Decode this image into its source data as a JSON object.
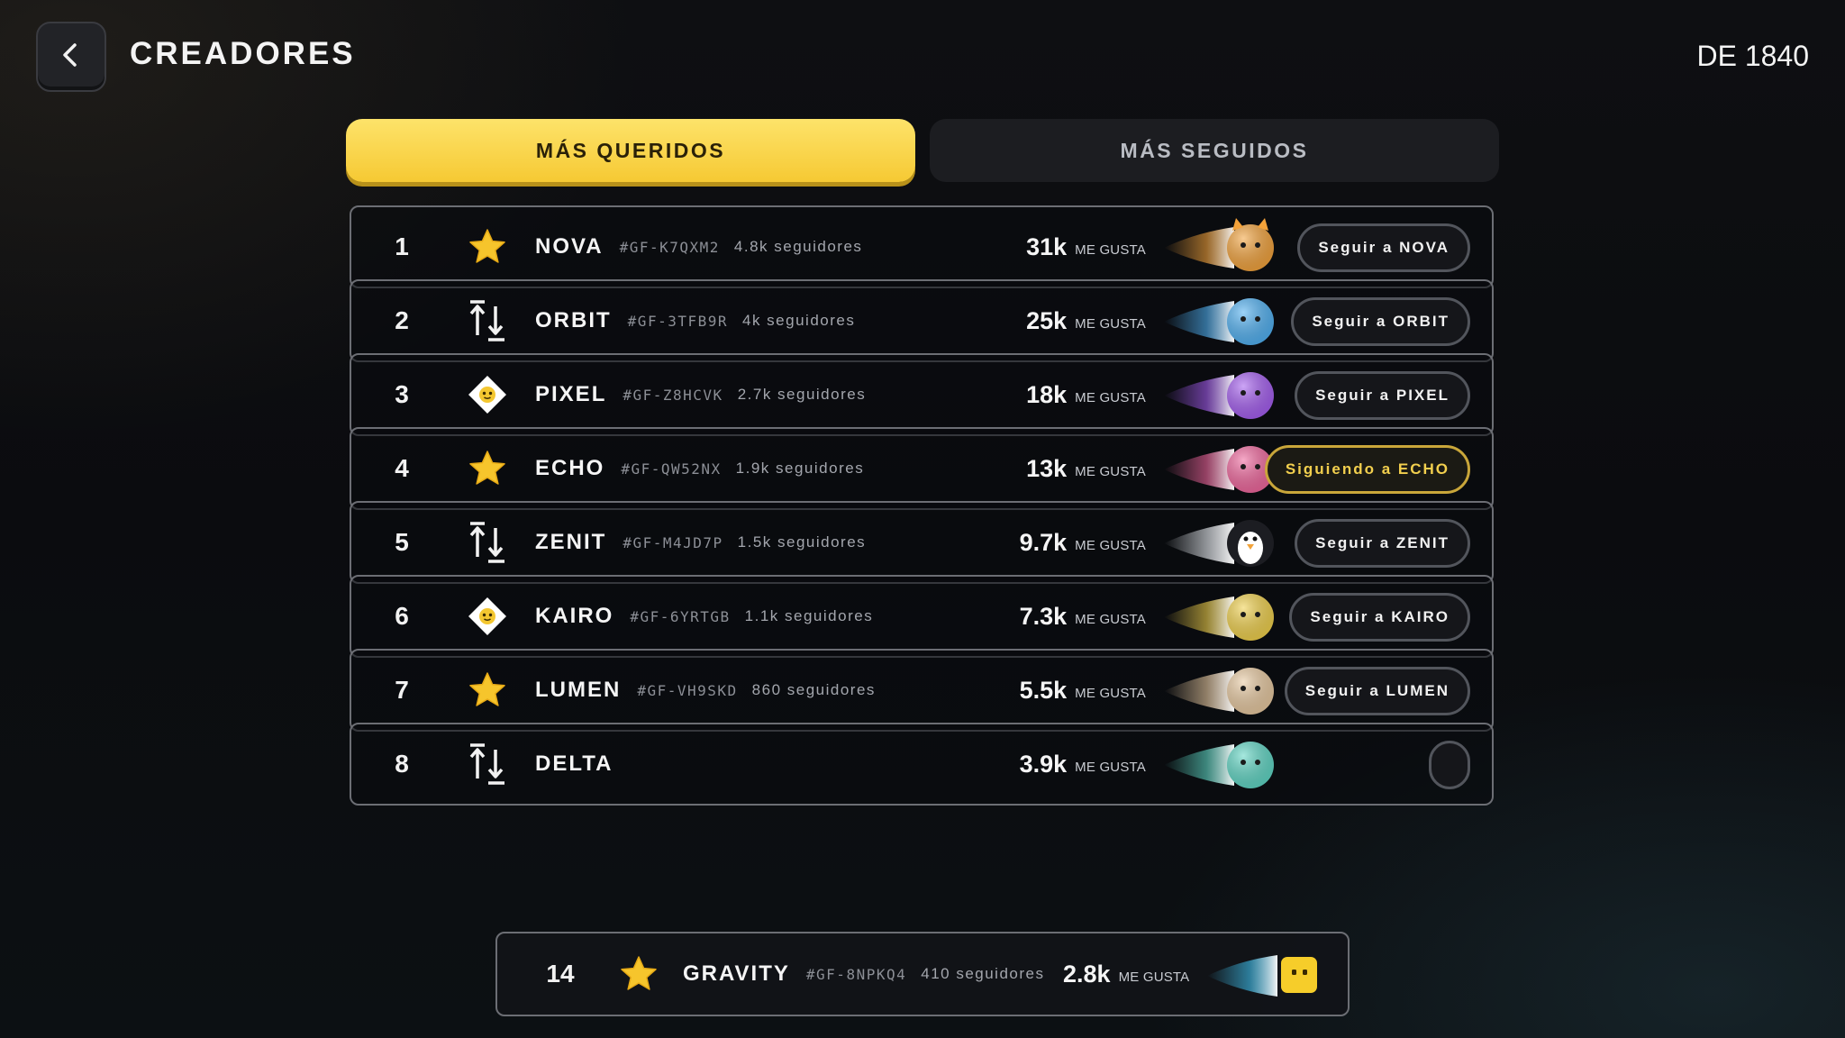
{
  "header": {
    "title": "CREADORES",
    "rank_context": "DE 1840"
  },
  "tabs": [
    {
      "label": "MÁS QUERIDOS",
      "active": true
    },
    {
      "label": "MÁS SEGUIDOS",
      "active": false
    }
  ],
  "likes_unit": "ME GUSTA",
  "creators": [
    {
      "rank": "1",
      "badge": "star-icon",
      "name": "NOVA",
      "code": "#GF-K7QXM2",
      "followers": "4.8k seguidores",
      "likes": "31k",
      "follow_label": "Seguir a NOVA",
      "following": false,
      "avatar": "cat-icon",
      "comet_color": "#f3a23a"
    },
    {
      "rank": "2",
      "badge": "swap-arrows-icon",
      "name": "ORBIT",
      "code": "#GF-3TFB9R",
      "followers": "4k seguidores",
      "likes": "25k",
      "follow_label": "Seguir a ORBIT",
      "following": false,
      "avatar": "crystal-icon",
      "comet_color": "#4fb0f2"
    },
    {
      "rank": "3",
      "badge": "diamond-face-icon",
      "name": "PIXEL",
      "code": "#GF-Z8HCVK",
      "followers": "2.7k seguidores",
      "likes": "18k",
      "follow_label": "Seguir a PIXEL",
      "following": false,
      "avatar": "octopus-icon",
      "comet_color": "#a45cf0"
    },
    {
      "rank": "4",
      "badge": "star-icon",
      "name": "ECHO",
      "code": "#GF-QW52NX",
      "followers": "1.9k seguidores",
      "likes": "13k",
      "follow_label": "Siguiendo a ECHO",
      "following": true,
      "avatar": "flamingo-icon",
      "comet_color": "#f0659c"
    },
    {
      "rank": "5",
      "badge": "swap-arrows-icon",
      "name": "ZENIT",
      "code": "#GF-M4JD7P",
      "followers": "1.5k seguidores",
      "likes": "9.7k",
      "follow_label": "Seguir a ZENIT",
      "following": false,
      "avatar": "penguin-icon",
      "comet_color": "#e9edf2"
    },
    {
      "rank": "6",
      "badge": "diamond-face-icon",
      "name": "KAIRO",
      "code": "#GF-6YRTGB",
      "followers": "1.1k seguidores",
      "likes": "7.3k",
      "follow_label": "Seguir a KAIRO",
      "following": false,
      "avatar": "prism-icon",
      "comet_color": "#f0d04a"
    },
    {
      "rank": "7",
      "badge": "star-icon",
      "name": "LUMEN",
      "code": "#GF-VH9SKD",
      "followers": "860 seguidores",
      "likes": "5.5k",
      "follow_label": "Seguir a LUMEN",
      "following": false,
      "avatar": "moon-face-icon",
      "comet_color": "#e8c9a0"
    },
    {
      "rank": "8",
      "badge": "swap-arrows-icon",
      "name": "DELTA",
      "code": "",
      "followers": "",
      "likes": "3.9k",
      "follow_label": "",
      "following": false,
      "avatar": "leaf-icon",
      "comet_color": "#5ed6c4"
    }
  ],
  "current_user": {
    "rank": "14",
    "badge": "star-icon",
    "name": "GRAVITY",
    "code": "#GF-8NPKQ4",
    "followers": "410 seguidores",
    "likes": "2.8k",
    "avatar": "yellow-cube-icon",
    "comet_color": "#3fc2f0"
  }
}
